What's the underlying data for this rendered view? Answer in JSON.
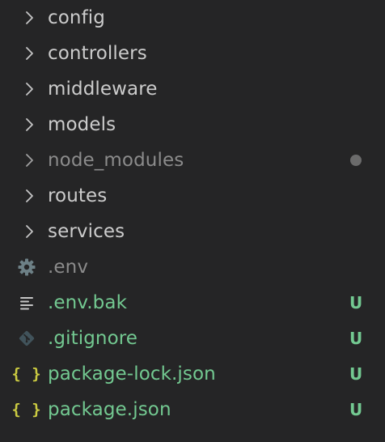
{
  "colors": {
    "background": "#252526",
    "folder_text": "#cccccc",
    "dimmed_text": "#8b8b8b",
    "untracked": "#73c991",
    "chevron": "#c5c5c5",
    "json_icon": "#cbcb41",
    "git_icon": "#41535b",
    "gear_icon": "#6d8086",
    "bak_icon": "#c5c5c5",
    "dot": "#6b6b6b"
  },
  "explorer": {
    "folders": [
      {
        "name": "config"
      },
      {
        "name": "controllers"
      },
      {
        "name": "middleware"
      },
      {
        "name": "models"
      },
      {
        "name": "node_modules",
        "ignored": true
      },
      {
        "name": "routes"
      },
      {
        "name": "services"
      }
    ],
    "files": [
      {
        "name": ".env",
        "icon": "gear-icon",
        "status": ""
      },
      {
        "name": ".env.bak",
        "icon": "lines-icon",
        "status": "U"
      },
      {
        "name": ".gitignore",
        "icon": "git-icon",
        "status": "U"
      },
      {
        "name": "package-lock.json",
        "icon": "json-braces-icon",
        "icon_glyph": "{}",
        "status": "U"
      },
      {
        "name": "package.json",
        "icon": "json-braces-icon",
        "icon_glyph": "{}",
        "status": "U"
      }
    ]
  }
}
